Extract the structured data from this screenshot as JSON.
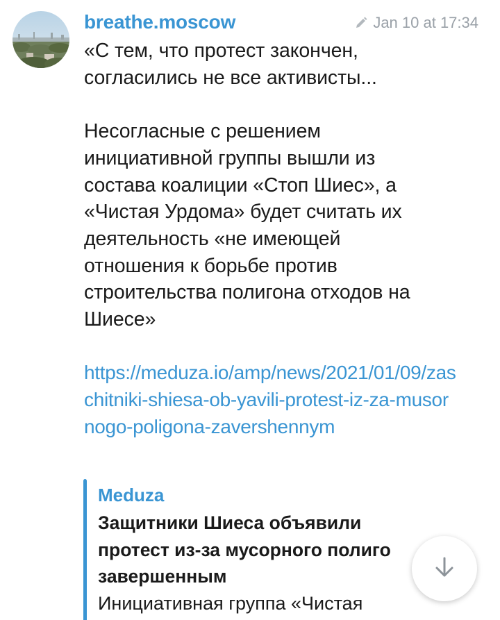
{
  "channel": {
    "name": "breathe.moscow",
    "avatar_icon": "city-skyline-photo"
  },
  "message": {
    "edited_icon": "pencil-icon",
    "timestamp": "Jan 10 at 17:34",
    "text": "«С тем, что протест закончен,\nсогласились не все активисты...\n\nНесогласные с решением\nинициативной группы вышли из\nсостава коалиции «Стоп Шиес», а\n«Чистая Урдома» будет считать их\nдеятельность «не имеющей\nотношения к борьбе против\nстроительства полигона отходов на\nШиесе»\n\n",
    "link": "https://meduza.io/amp/news/2021/01/09/zaschitniki-shiesa-ob-yavili-protest-iz-za-musornogo-poligona-zavershennym"
  },
  "preview": {
    "site": "Meduza",
    "title": "Защитники Шиеса объявили\nпротест из-за мусорного полиго\nзавершенным",
    "description": "Инициативная группа «Чистая"
  },
  "controls": {
    "scroll_down_icon": "arrow-down-icon"
  },
  "colors": {
    "accent": "#3a95d3",
    "text": "#1a1a1a",
    "meta": "#9aa1a8"
  }
}
